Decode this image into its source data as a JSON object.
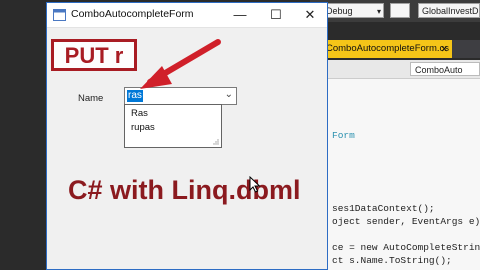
{
  "window": {
    "title": "ComboAutocompleteForm",
    "minimize_glyph": "—",
    "maximize_glyph": "☐",
    "close_glyph": "✕"
  },
  "annotation": {
    "label": "PUT r",
    "color": "#a81c23"
  },
  "form": {
    "name_label": "Name",
    "combo_value": "ras",
    "combo_chevron": "⌄",
    "suggestions": [
      "Ras",
      "rupas"
    ]
  },
  "caption": "C# with Linq.dbml",
  "ide": {
    "debug_dropdown": "Debug",
    "platform_dropdown": "",
    "project_dropdown": "GlobalInvestDB",
    "tab_title": "ComboAutocompleteForm.cs",
    "tab_close": "✕",
    "nav_dropdown": "ComboAuto",
    "code_lines": [
      "Form",
      "ses1DataContext();",
      "oject sender, EventArgs e)",
      "ce = new AutoCompleteStringCo",
      "ct s.Name.ToString();"
    ]
  },
  "icons": {
    "app": "form-app-icon",
    "cursor": "mouse-pointer-icon",
    "arrow": "annotation-arrow-icon",
    "resize": "resize-grip-icon"
  }
}
